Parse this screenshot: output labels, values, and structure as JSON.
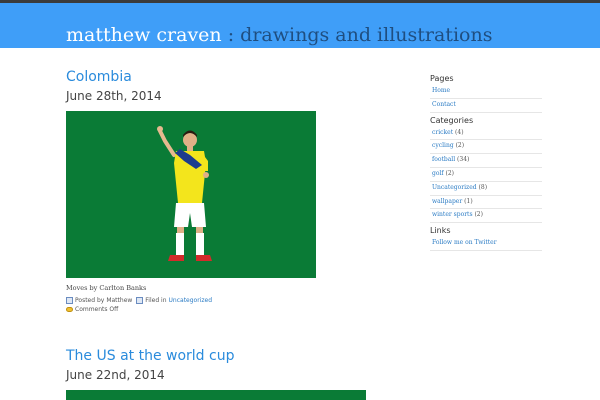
{
  "header": {
    "site_name": "matthew craven",
    "separator": ":",
    "tagline": "drawings and illustrations"
  },
  "posts": [
    {
      "title": "Colombia",
      "date": "June 28th, 2014",
      "caption": "Moves by Carlton Banks",
      "meta": {
        "posted_by_label": "Posted by",
        "author": "Matthew",
        "filed_in_label": "Filed in",
        "category": "Uncategorized",
        "comments": "Comments Off"
      }
    },
    {
      "title": "The US at the world cup",
      "date": "June 22nd, 2014"
    }
  ],
  "sidebar": {
    "pages_heading": "Pages",
    "pages": [
      {
        "label": "Home"
      },
      {
        "label": "Contact"
      }
    ],
    "categories_heading": "Categories",
    "categories": [
      {
        "label": "cricket",
        "count": "(4)"
      },
      {
        "label": "cycling",
        "count": "(2)"
      },
      {
        "label": "football",
        "count": "(34)"
      },
      {
        "label": "golf",
        "count": "(2)"
      },
      {
        "label": "Uncategorized",
        "count": "(8)"
      },
      {
        "label": "wallpaper",
        "count": "(1)"
      },
      {
        "label": "winter sports",
        "count": "(2)"
      }
    ],
    "links_heading": "Links",
    "links": [
      {
        "label": "Follow me on Twitter"
      }
    ]
  },
  "colors": {
    "header_bg": "#3f9ef8",
    "image_green": "#0a7b36",
    "link_blue": "#2a8bdc",
    "jersey_yellow": "#f3e51c",
    "jersey_blue": "#1d3c8e"
  }
}
